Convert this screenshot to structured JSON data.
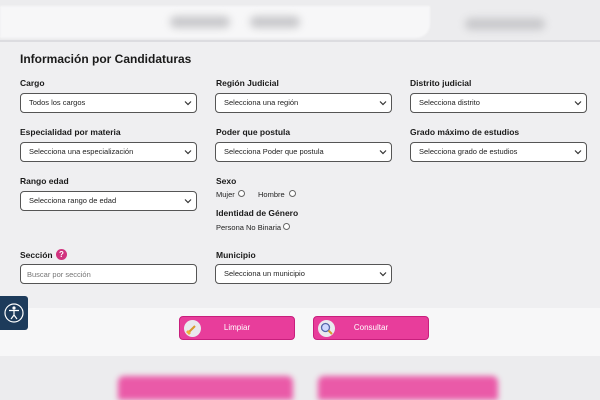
{
  "section_title": "Información por Candidaturas",
  "fields": {
    "cargo": {
      "label": "Cargo",
      "value": "Todos los cargos"
    },
    "region": {
      "label": "Región Judicial",
      "value": "Selecciona una región"
    },
    "distrito": {
      "label": "Distrito judicial",
      "value": "Selecciona distrito"
    },
    "especialidad": {
      "label": "Especialidad por materia",
      "value": "Selecciona una especialización"
    },
    "poder": {
      "label": "Poder que postula",
      "value": "Selecciona Poder que postula"
    },
    "grado": {
      "label": "Grado máximo de estudios",
      "value": "Selecciona grado de estudios"
    },
    "edad": {
      "label": "Rango edad",
      "value": "Selecciona rango de edad"
    },
    "municipio": {
      "label": "Municipio",
      "value": "Selecciona un municipio"
    },
    "seccion": {
      "label": "Sección",
      "help": "?",
      "placeholder": "Buscar por sección"
    }
  },
  "sexo": {
    "label": "Sexo",
    "options": [
      "Mujer",
      "Hombre"
    ]
  },
  "genero": {
    "label": "Identidad de Género",
    "options": [
      "Persona No Binaria"
    ]
  },
  "buttons": {
    "limpiar": "Limpiar",
    "consultar": "Consultar"
  },
  "colors": {
    "accent": "#e83d9b",
    "help": "#d1337f",
    "side_tab": "#1d3b5b"
  },
  "icons": {
    "chevron": "chevron-down-icon",
    "limpiar": "broom-icon",
    "consultar": "magnifier-icon",
    "accessibility": "accessibility-icon"
  }
}
